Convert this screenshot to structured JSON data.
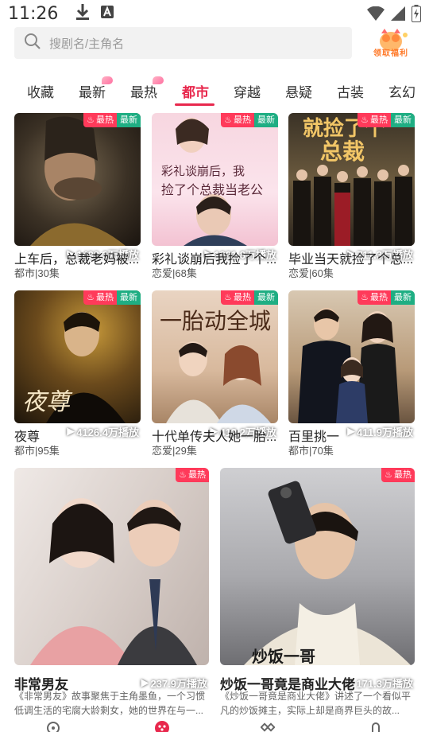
{
  "status": {
    "time": "11:26"
  },
  "search": {
    "placeholder": "搜剧名/主角名"
  },
  "welfare": {
    "label": "领取福利"
  },
  "tabs": [
    {
      "label": "收藏"
    },
    {
      "label": "最新"
    },
    {
      "label": "最热"
    },
    {
      "label": "都市"
    },
    {
      "label": "穿越"
    },
    {
      "label": "悬疑"
    },
    {
      "label": "古装"
    },
    {
      "label": "玄幻"
    }
  ],
  "active_tab": "都市",
  "colors": {
    "accent": "#e8284d",
    "hot_tag": "#ff3a5a",
    "new_tag": "#1fae83"
  },
  "tags": {
    "hot": "最热",
    "new": "最新"
  },
  "grid": [
    {
      "title": "上车后，总裁老妈被...",
      "meta": "都市|30集",
      "plays": "1492.3万播放",
      "poster_text": ""
    },
    {
      "title": "彩礼谈崩后我捡了个...",
      "meta": "恋爱|68集",
      "plays": "1321.8万播放",
      "poster_text": "彩礼谈崩后，我捡了个总裁当老公"
    },
    {
      "title": "毕业当天就捡了个总...",
      "meta": "恋爱|60集",
      "plays": "711.3万播放",
      "poster_text": "就捡了个总裁"
    },
    {
      "title": "夜尊",
      "meta": "都市|95集",
      "plays": "4126.4万播放",
      "poster_text": "夜尊"
    },
    {
      "title": "十代单传夫人她一胎...",
      "meta": "恋爱|29集",
      "plays": "412.2万播放",
      "poster_text": "一胎动全城"
    },
    {
      "title": "百里挑一",
      "meta": "都市|70集",
      "plays": "411.9万播放",
      "poster_text": ""
    }
  ],
  "featured": [
    {
      "title": "非常男友",
      "plays": "237.9万播放",
      "desc": "《非常男友》故事聚焦于主角墨鱼，一个习惯低调生活的宅腐大龄剩女，她的世界在与一..."
    },
    {
      "title": "炒饭一哥竟是商业大佬",
      "plays": "171.3万播放",
      "desc": "《炒饭一哥竟是商业大佬》讲述了一个看似平凡的炒饭摊主，实际上却是商界巨头的故..."
    }
  ],
  "icons": {
    "search": "search-icon",
    "download": "download-icon",
    "font": "font-icon",
    "wifi": "wifi-icon",
    "signal": "signal-icon",
    "battery": "battery-icon",
    "play": "play-icon",
    "fire": "fire-icon"
  }
}
